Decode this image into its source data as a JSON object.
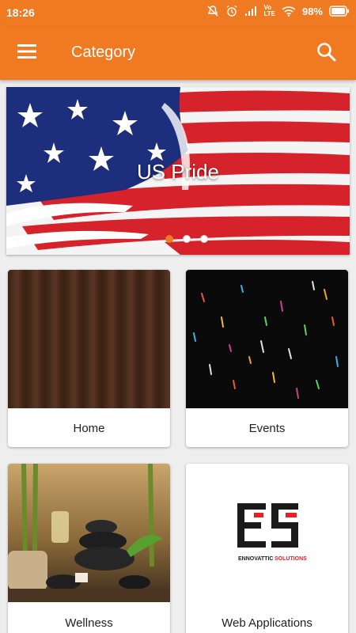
{
  "status_bar": {
    "time": "18:26",
    "battery": "98%",
    "network_label": "LTE",
    "volte_label": "Vo"
  },
  "app_bar": {
    "title": "Category",
    "background_color": "#f07a22"
  },
  "banner": {
    "title": "US Pride",
    "slide_index": 1,
    "slide_count": 3
  },
  "categories": [
    {
      "label": "Home"
    },
    {
      "label": "Events"
    },
    {
      "label": "Wellness"
    },
    {
      "label": "Web Applications"
    }
  ],
  "web_logo": {
    "letters": "ES",
    "company_first": "ENNOVATTIC",
    "company_second": "SOLUTIONS",
    "accent_color": "#e22228"
  },
  "icons": [
    "menu-icon",
    "search-icon",
    "alarm-icon",
    "wifi-icon",
    "signal-icon",
    "battery-icon",
    "notifications-off-icon"
  ]
}
